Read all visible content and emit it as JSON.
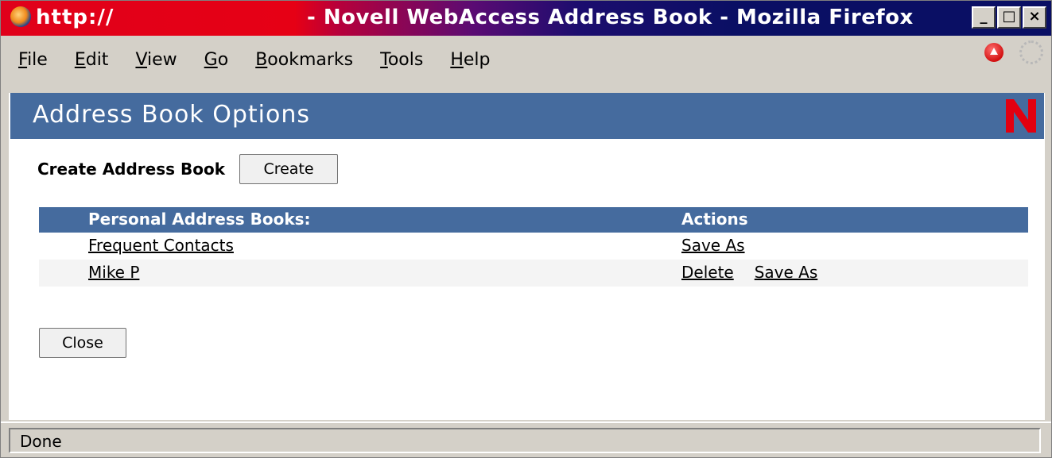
{
  "window": {
    "title_url": "http://",
    "title": "- Novell WebAccess Address Book - Mozilla Firefox",
    "controls": {
      "minimize": "_",
      "maximize": "□",
      "close": "×"
    }
  },
  "menubar": {
    "items": [
      {
        "accel": "F",
        "rest": "ile"
      },
      {
        "accel": "E",
        "rest": "dit"
      },
      {
        "accel": "V",
        "rest": "iew"
      },
      {
        "accel": "G",
        "rest": "o"
      },
      {
        "accel": "B",
        "rest": "ookmarks"
      },
      {
        "accel": "T",
        "rest": "ools"
      },
      {
        "accel": "H",
        "rest": "elp"
      }
    ]
  },
  "page": {
    "header_title": "Address Book Options",
    "logo_letter": "N",
    "create_label": "Create Address Book",
    "create_button": "Create",
    "table": {
      "col_name": "Personal Address Books:",
      "col_actions": "Actions",
      "rows": [
        {
          "name": "Frequent Contacts",
          "actions": [
            "Save As"
          ]
        },
        {
          "name": "Mike P",
          "actions": [
            "Delete",
            "Save As"
          ]
        }
      ]
    },
    "close_button": "Close"
  },
  "statusbar": {
    "text": "Done"
  },
  "colors": {
    "header_blue": "#456b9e",
    "novell_red": "#e20010"
  }
}
